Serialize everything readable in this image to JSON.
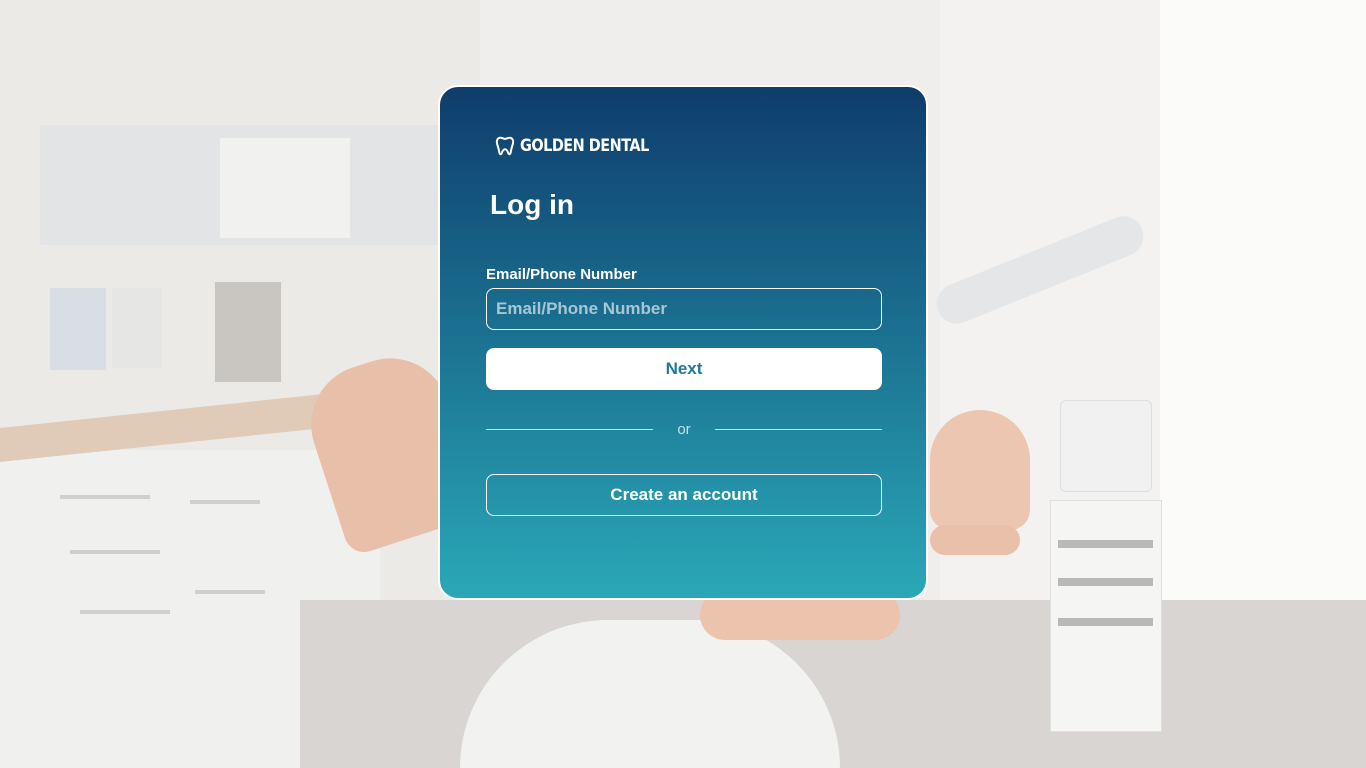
{
  "brand": {
    "name": "GOLDEN DENTAL",
    "icon": "tooth-icon"
  },
  "login": {
    "title": "Log in",
    "identifier_label": "Email/Phone Number",
    "identifier_placeholder": "Email/Phone Number",
    "identifier_value": "",
    "next_label": "Next",
    "divider_text": "or",
    "create_account_label": "Create an account"
  },
  "colors": {
    "card_gradient_top": "#0f3d6b",
    "card_gradient_bottom": "#2aa8b8",
    "next_button_text": "#1f7a9a",
    "white": "#ffffff"
  }
}
